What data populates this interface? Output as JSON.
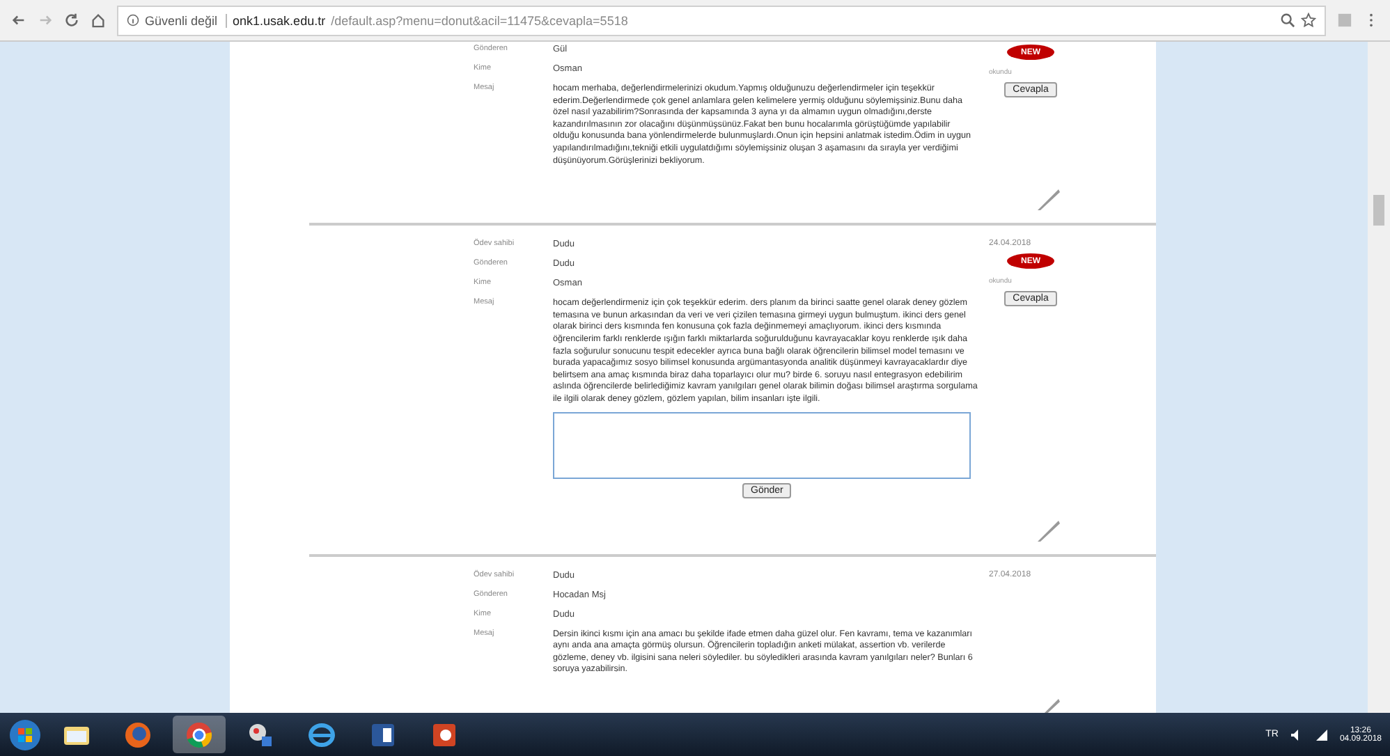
{
  "browser": {
    "security": "Güvenli değil",
    "url_domain": "onk1.usak.edu.tr",
    "url_path": "/default.asp?menu=donut&acil=11475&cevapla=5518"
  },
  "messages": [
    {
      "fields": [
        {
          "label": "Gönderen",
          "value": "Gül"
        },
        {
          "label": "Kime",
          "value": "Osman"
        }
      ],
      "message_label": "Mesaj",
      "message": "hocam merhaba, değerlendirmelerinizi okudum.Yapmış olduğunuzu değerlendirmeler için teşekkür ederim.Değerlendirmede çok genel anlamlara gelen kelimelere yermiş olduğunu söylemişsiniz.Bunu daha özel nasıl yazabilirim?Sonrasında der kapsamında 3 ayna yı da almamın uygun olmadığını,derste kazandırılmasının zor olacağını düşünmüşsünüz.Fakat ben bunu hocalarımla görüştüğümde yapılabilir olduğu konusunda bana yönlendirmelerde bulunmuşlardı.Onun için hepsini anlatmak istedim.Ödim in uygun yapılandırılmadığını,tekniği etkili uygulatdığımı söylemişsiniz oluşan 3 aşamasını da sırayla yer verdiğimi düşünüyorum.Görüşlerinizi bekliyorum.",
      "badge": "NEW",
      "status": "okundu",
      "reply_button": "Cevapla"
    },
    {
      "date": "24.04.2018",
      "fields": [
        {
          "label": "Ödev sahibi",
          "value": "Dudu"
        },
        {
          "label": "Gönderen",
          "value": "Dudu"
        },
        {
          "label": "Kime",
          "value": "Osman"
        }
      ],
      "message_label": "Mesaj",
      "message": "hocam değerlendirmeniz için çok teşekkür ederim. ders planım da birinci saatte genel olarak deney gözlem temasına ve bunun arkasından da veri ve veri çizilen temasına girmeyi uygun bulmuştum. ikinci ders genel olarak birinci ders kısmında fen konusuna çok fazla değinmemeyi amaçlıyorum. ikinci ders kısmında öğrencilerim farklı renklerde ışığın farklı miktarlarda soğurulduğunu kavrayacaklar koyu renklerde ışık daha fazla soğurulur sonucunu tespit edecekler ayrıca buna bağlı olarak öğrencilerin bilimsel model temasını ve burada yapacağımız sosyo bilimsel konusunda argümantasyonda analitik düşünmeyi kavrayacaklardır diye belirtsem ana amaç kısmında biraz daha toparlayıcı olur mu? birde 6. soruyu nasıl entegrasyon edebilirim aslında öğrencilerde belirlediğimiz kavram yanılgıları genel olarak bilimin doğası bilimsel araştırma sorgulama ile ilgili olarak deney gözlem, gözlem yapılan, bilim insanları işte ilgili.",
      "badge": "NEW",
      "status": "okundu",
      "reply_button": "Cevapla",
      "reply_form": {
        "send_button": "Gönder"
      }
    },
    {
      "date": "27.04.2018",
      "fields": [
        {
          "label": "Ödev sahibi",
          "value": "Dudu"
        },
        {
          "label": "Gönderen",
          "value": "Hocadan Msj"
        },
        {
          "label": "Kime",
          "value": "Dudu"
        }
      ],
      "message_label": "Mesaj",
      "message": "Dersin ikinci kısmı için ana amacı bu şekilde ifade etmen daha güzel olur. Fen kavramı, tema ve kazanımları aynı anda ana amaçta görmüş olursun. Öğrencilerin topladığın anketi mülakat, assertion vb. verilerde gözleme, deney vb. ilgisini sana neleri söylediler. bu söyledikleri arasında kavram yanılgıları neler? Bunları 6 soruya yazabilirsin."
    }
  ],
  "taskbar": {
    "apps": [
      {
        "kind": "folder",
        "selected": false
      },
      {
        "kind": "firefox",
        "selected": false
      },
      {
        "kind": "chrome",
        "selected": true
      },
      {
        "kind": "paint",
        "selected": false
      },
      {
        "kind": "ie",
        "selected": false
      },
      {
        "kind": "word",
        "selected": false
      },
      {
        "kind": "powerpoint",
        "selected": false
      }
    ],
    "language": "TR",
    "time": "13:26",
    "date": "04.09.2018"
  }
}
